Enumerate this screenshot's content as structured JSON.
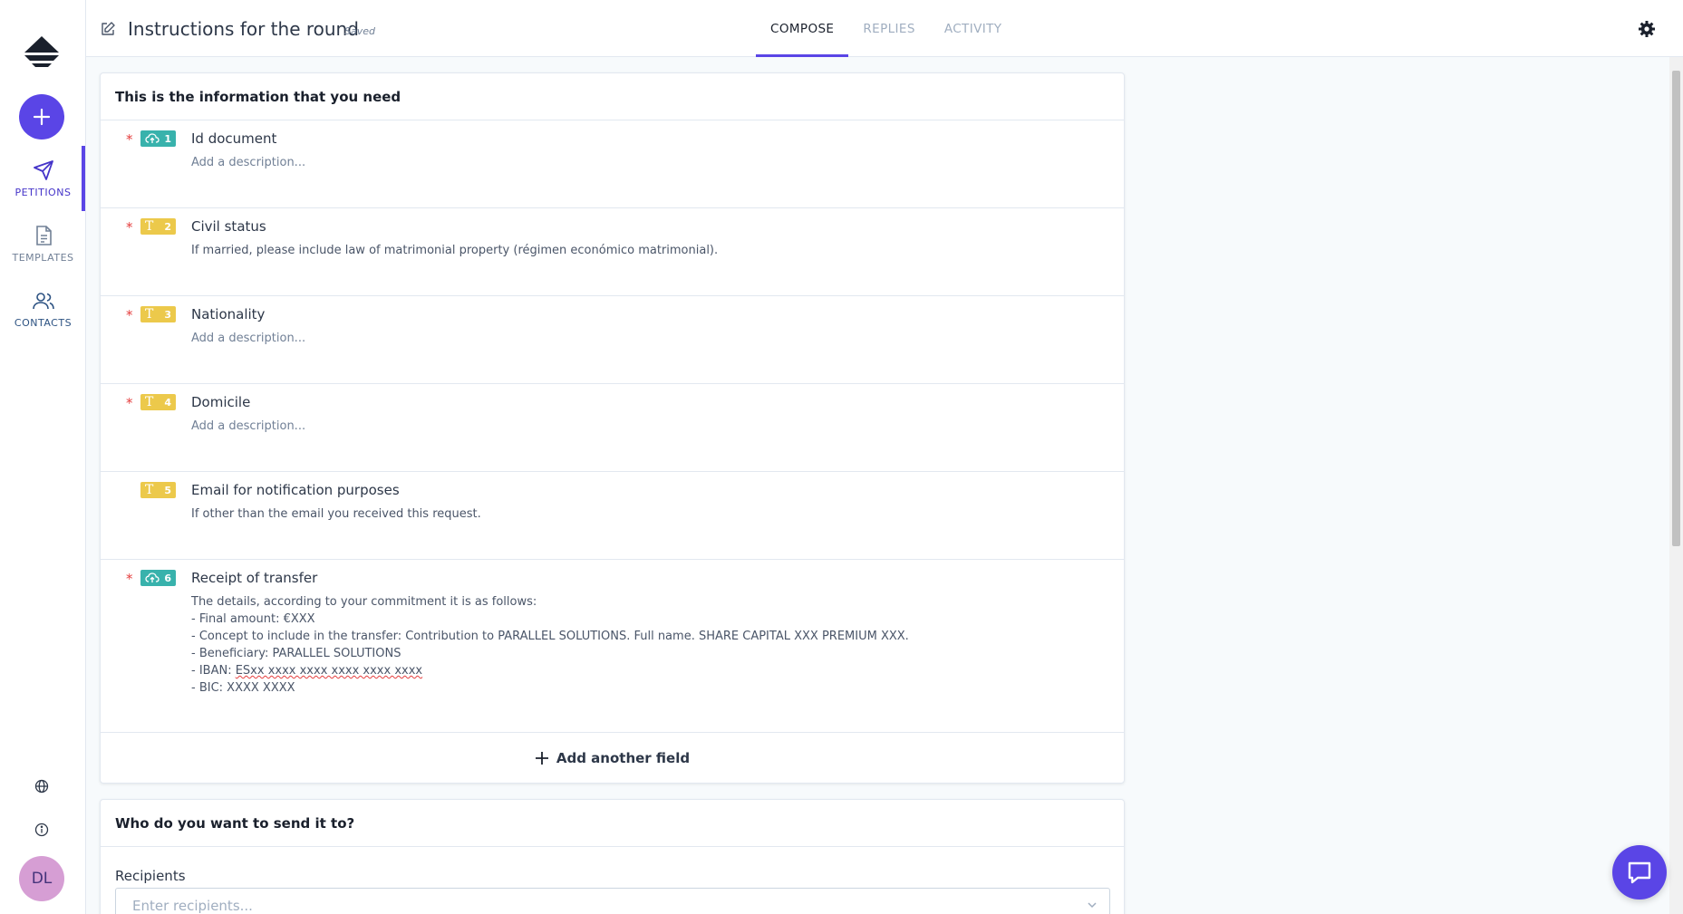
{
  "header": {
    "title": "Instructions for the round",
    "status": "Saved",
    "tabs": [
      {
        "label": "COMPOSE",
        "active": true
      },
      {
        "label": "REPLIES",
        "active": false
      },
      {
        "label": "ACTIVITY",
        "active": false
      }
    ]
  },
  "sidebar": {
    "items": [
      {
        "label": "PETITIONS",
        "icon": "paper-plane-icon",
        "active": true
      },
      {
        "label": "TEMPLATES",
        "icon": "document-icon",
        "active": false
      },
      {
        "label": "CONTACTS",
        "icon": "users-icon",
        "active": false
      }
    ],
    "avatar_initials": "DL"
  },
  "fields_section": {
    "heading": "This is the information that you need",
    "fields": [
      {
        "number": "1",
        "type": "file",
        "required": true,
        "title": "Id document",
        "description": "Add a description...",
        "placeholder": true
      },
      {
        "number": "2",
        "type": "text",
        "required": true,
        "title": "Civil status",
        "description": "If married, please include law of matrimonial property (régimen económico matrimonial).",
        "placeholder": false
      },
      {
        "number": "3",
        "type": "text",
        "required": true,
        "title": "Nationality",
        "description": "Add a description...",
        "placeholder": true
      },
      {
        "number": "4",
        "type": "text",
        "required": true,
        "title": "Domicile",
        "description": "Add a description...",
        "placeholder": true
      },
      {
        "number": "5",
        "type": "text",
        "required": false,
        "title": "Email for notification purposes",
        "description": "If other than the email you received this request.",
        "placeholder": false
      },
      {
        "number": "6",
        "type": "file",
        "required": true,
        "title": "Receipt of transfer",
        "description": "The details, according to your commitment it is as follows:\n- Final amount: €XXX\n- Concept to include in the transfer: Contribution to PARALLEL SOLUTIONS. Full name. SHARE CAPITAL XXX PREMIUM XXX.\n- Beneficiary: PARALLEL SOLUTIONS\n- IBAN: ESxx xxxx xxxx xxxx xxxx xxxx\n- BIC: XXXX XXXX",
        "placeholder": false
      }
    ],
    "add_field_label": "Add another field",
    "badge_text_glyph": "T"
  },
  "recipients_section": {
    "heading": "Who do you want to send it to?",
    "label": "Recipients",
    "placeholder": "Enter recipients..."
  },
  "colors": {
    "accent": "#5a45e6",
    "file_badge": "#38b2ac",
    "text_badge": "#ecc94b",
    "required": "#e53e3e"
  }
}
